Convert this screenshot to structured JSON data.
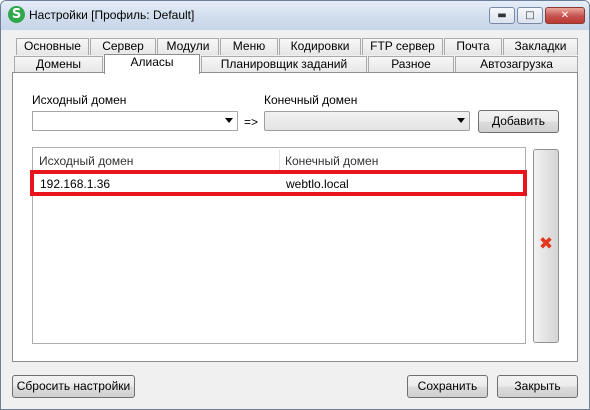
{
  "window": {
    "title": "Настройки [Профиль: Default]",
    "app_icon_glyph": "S",
    "min_glyph": "▬",
    "max_glyph": "□",
    "close_glyph": "✕"
  },
  "tabs_row1": [
    "Основные",
    "Сервер",
    "Модули",
    "Меню",
    "Кодировки",
    "FTP сервер",
    "Почта",
    "Закладки"
  ],
  "tabs_row2": [
    "Домены",
    "Алиасы",
    "Планировщик заданий",
    "Разное",
    "Автозагрузка"
  ],
  "active_tab": "Алиасы",
  "form": {
    "source_label": "Исходный домен",
    "target_label": "Конечный домен",
    "arrow_text": "=>",
    "source_value": "",
    "target_value": "",
    "add_button": "Добавить"
  },
  "table": {
    "columns": [
      "Исходный домен",
      "Конечный домен"
    ],
    "rows": [
      [
        "192.168.1.36",
        "webtlo.local"
      ]
    ]
  },
  "delete_icon": "✖",
  "footer": {
    "reset_button": "Сбросить настройки",
    "save_button": "Сохранить",
    "close_button": "Закрыть"
  },
  "colors": {
    "highlight": "#e8141b",
    "delete_icon": "#e2371e",
    "app_icon": "#2ea84a"
  }
}
